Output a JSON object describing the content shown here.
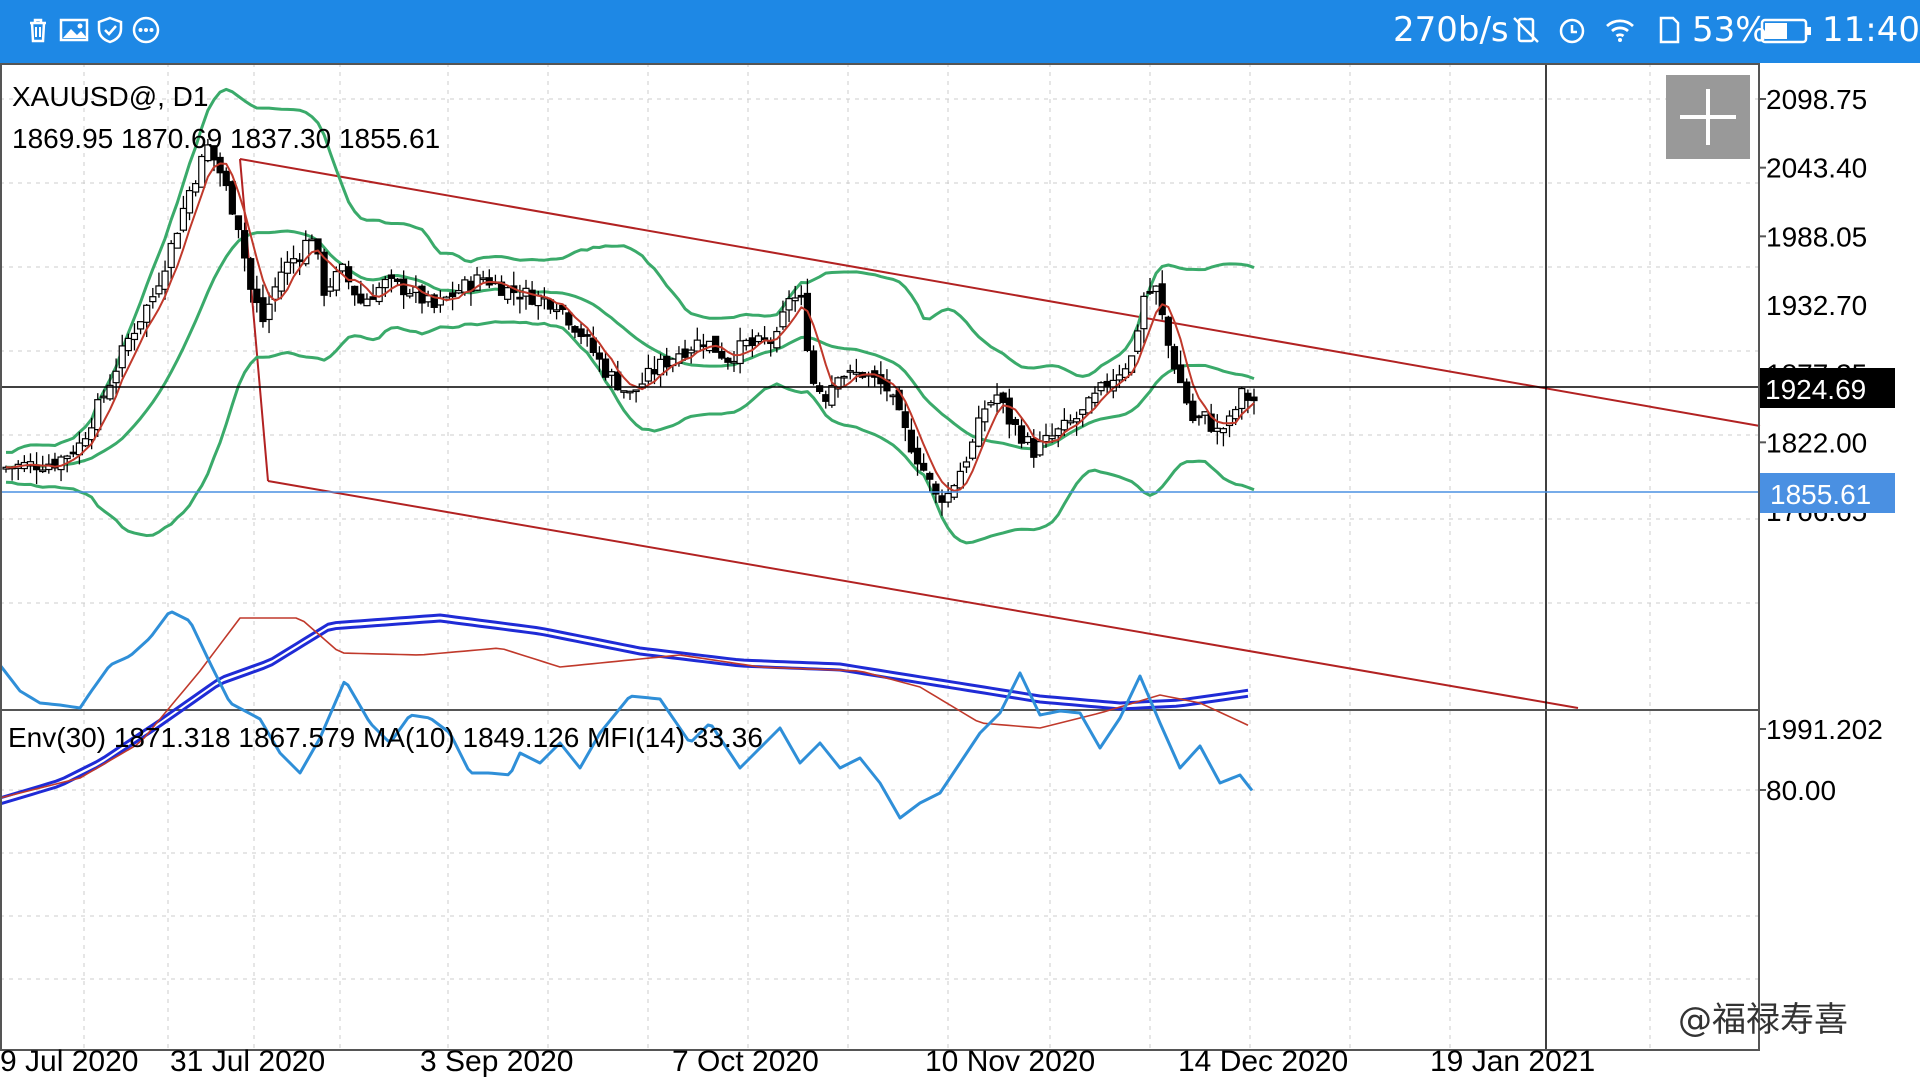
{
  "status_bar": {
    "left_icons": [
      "trash-icon",
      "image-icon",
      "shield-icon",
      "more-icon"
    ],
    "speed": "270b/s",
    "battery": "53%",
    "time": "11:40",
    "right_icons": [
      "mute-icon",
      "alarm-icon",
      "wifi-icon",
      "sim-icon",
      "battery-icon"
    ],
    "bg_color": "#1e88e5"
  },
  "chart_data": {
    "type": "candlestick",
    "symbol": "XAUUSD@, D1",
    "ohlc_readout": "1869.95 1870.69 1837.30 1855.61",
    "indicator_readout": "Env(30) 1871.318 1867.579 MA(10) 1849.126 MFI(14) 33.36",
    "price_axis_labels": [
      "2098.75",
      "2043.40",
      "1988.05",
      "1877.35",
      "1822.00",
      "1766.65"
    ],
    "hidden_label": "1932.70",
    "crosshair_price": "1924.69",
    "last_price": "1855.61",
    "indicator_axis_labels": [
      "1991.202",
      "80.00"
    ],
    "x_tick_labels": [
      "9 Jul 2020",
      "31 Jul 2020",
      "3 Sep 2020",
      "7 Oct 2020",
      "10 Nov 2020",
      "14 Dec 2020",
      "19 Jan 2021"
    ],
    "watermark": "@福禄寿喜",
    "colors": {
      "candle": "#000000",
      "bollinger": "#3aaa6a",
      "ma": "#c0392b",
      "channel": "#b22222",
      "envelope": "#1f2bd6",
      "mfi": "#2f8fd8",
      "last_price_line": "#4a90e2",
      "crosshair": "#000000"
    }
  }
}
